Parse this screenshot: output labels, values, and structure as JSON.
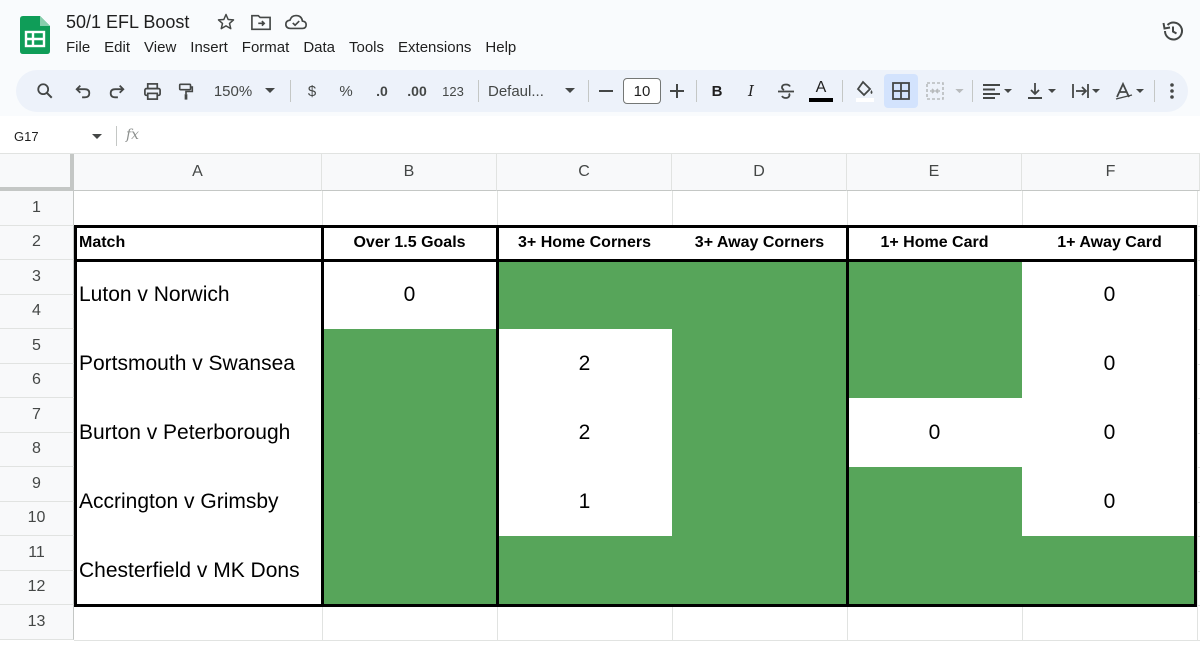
{
  "app": {
    "doc_title": "50/1 EFL Boost",
    "menu": [
      "File",
      "Edit",
      "View",
      "Insert",
      "Format",
      "Data",
      "Tools",
      "Extensions",
      "Help"
    ]
  },
  "toolbar": {
    "zoom": "150%",
    "currency": "$",
    "percent": "%",
    "decrease_decimal": ".0",
    "increase_decimal": ".00",
    "number_format": "123",
    "font": "Defaul...",
    "font_size": "10",
    "bold": "B",
    "italic": "I",
    "text_color": "A"
  },
  "formula_bar": {
    "name_box": "G17",
    "fx": "fx"
  },
  "colors": {
    "green": "#57a55a",
    "white": "#ffffff",
    "border": "#000000"
  },
  "grid": {
    "columns": [
      "A",
      "B",
      "C",
      "D",
      "E",
      "F"
    ],
    "rows": [
      "1",
      "2",
      "3",
      "4",
      "5",
      "6",
      "7",
      "8",
      "9",
      "10",
      "11",
      "12",
      "13"
    ],
    "headers": [
      "Match",
      "Over 1.5 Goals",
      "3+ Home Corners",
      "3+ Away Corners",
      "1+ Home Card",
      "1+ Away Card"
    ],
    "matches": [
      {
        "match": "Luton v Norwich",
        "cells": [
          {
            "fill": "white",
            "value": "0"
          },
          {
            "fill": "green",
            "value": ""
          },
          {
            "fill": "green",
            "value": ""
          },
          {
            "fill": "green",
            "value": ""
          },
          {
            "fill": "white",
            "value": "0"
          }
        ]
      },
      {
        "match": "Portsmouth v Swansea",
        "cells": [
          {
            "fill": "green",
            "value": ""
          },
          {
            "fill": "white",
            "value": "2"
          },
          {
            "fill": "green",
            "value": ""
          },
          {
            "fill": "green",
            "value": ""
          },
          {
            "fill": "white",
            "value": "0"
          }
        ]
      },
      {
        "match": "Burton v Peterborough",
        "cells": [
          {
            "fill": "green",
            "value": ""
          },
          {
            "fill": "white",
            "value": "2"
          },
          {
            "fill": "green",
            "value": ""
          },
          {
            "fill": "white",
            "value": "0"
          },
          {
            "fill": "white",
            "value": "0"
          }
        ]
      },
      {
        "match": "Accrington v Grimsby",
        "cells": [
          {
            "fill": "green",
            "value": ""
          },
          {
            "fill": "white",
            "value": "1"
          },
          {
            "fill": "green",
            "value": ""
          },
          {
            "fill": "green",
            "value": ""
          },
          {
            "fill": "white",
            "value": "0"
          }
        ]
      },
      {
        "match": "Chesterfield v MK Dons",
        "cells": [
          {
            "fill": "green",
            "value": ""
          },
          {
            "fill": "green",
            "value": ""
          },
          {
            "fill": "green",
            "value": ""
          },
          {
            "fill": "green",
            "value": ""
          },
          {
            "fill": "green",
            "value": ""
          }
        ]
      }
    ]
  }
}
